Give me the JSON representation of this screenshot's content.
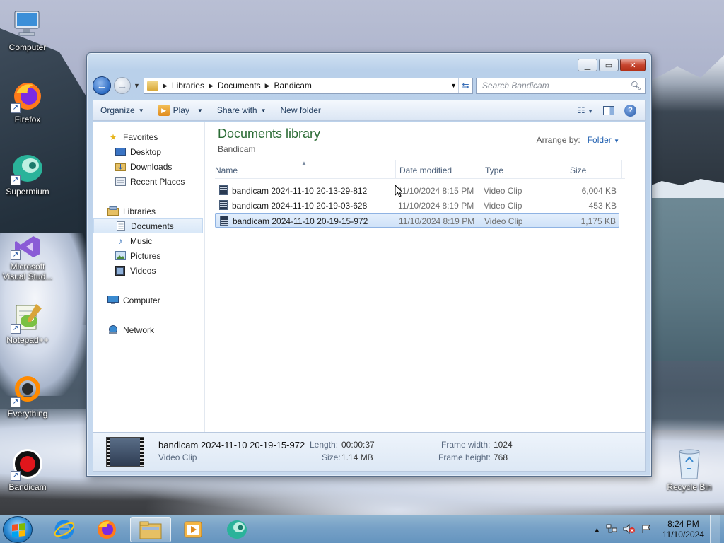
{
  "desktop": {
    "icons": [
      {
        "label": "Computer"
      },
      {
        "label": "Firefox"
      },
      {
        "label": "Supermium"
      },
      {
        "label": "Microsoft Visual Stud..."
      },
      {
        "label": "Notepad++"
      },
      {
        "label": "Everything"
      },
      {
        "label": "Bandicam"
      },
      {
        "label": "Recycle Bin"
      }
    ]
  },
  "window": {
    "address": {
      "segments": [
        "Libraries",
        "Documents",
        "Bandicam"
      ]
    },
    "search_placeholder": "Search Bandicam",
    "toolbar": {
      "organize": "Organize",
      "play": "Play",
      "share_with": "Share with",
      "new_folder": "New folder"
    },
    "nav": {
      "favorites": "Favorites",
      "desktop": "Desktop",
      "downloads": "Downloads",
      "recent_places": "Recent Places",
      "libraries": "Libraries",
      "documents": "Documents",
      "music": "Music",
      "pictures": "Pictures",
      "videos": "Videos",
      "computer": "Computer",
      "network": "Network"
    },
    "library": {
      "title": "Documents library",
      "subtitle": "Bandicam",
      "arrange_label": "Arrange by:",
      "arrange_value": "Folder"
    },
    "columns": {
      "name": "Name",
      "date": "Date modified",
      "type": "Type",
      "size": "Size"
    },
    "files": [
      {
        "name": "bandicam 2024-11-10 20-13-29-812",
        "date": "11/10/2024 8:15 PM",
        "type": "Video Clip",
        "size": "6,004 KB"
      },
      {
        "name": "bandicam 2024-11-10 20-19-03-628",
        "date": "11/10/2024 8:19 PM",
        "type": "Video Clip",
        "size": "453 KB"
      },
      {
        "name": "bandicam 2024-11-10 20-19-15-972",
        "date": "11/10/2024 8:19 PM",
        "type": "Video Clip",
        "size": "1,175 KB"
      }
    ],
    "details": {
      "name": "bandicam 2024-11-10 20-19-15-972",
      "type": "Video Clip",
      "length_label": "Length:",
      "length_value": "00:00:37",
      "size_label": "Size:",
      "size_value": "1.14 MB",
      "frame_width_label": "Frame width:",
      "frame_width_value": "1024",
      "frame_height_label": "Frame height:",
      "frame_height_value": "768"
    }
  },
  "taskbar": {
    "time": "8:24 PM",
    "date": "11/10/2024"
  },
  "colors": {
    "accent": "#2a6b34",
    "selection": "#cfe2f8",
    "link": "#1f5fb0"
  }
}
